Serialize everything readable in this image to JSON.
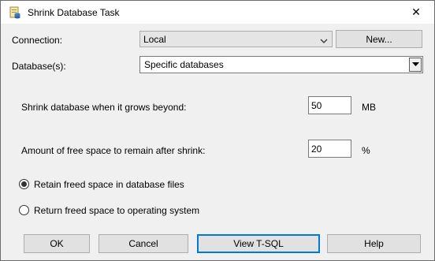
{
  "window": {
    "title": "Shrink Database Task",
    "close_symbol": "✕"
  },
  "icons": {
    "title": "database-task-icon",
    "close": "close-icon",
    "combo_arrow": "chevron-down-icon"
  },
  "connection": {
    "label": "Connection:",
    "value": "Local",
    "new_button": "New..."
  },
  "databases": {
    "label": "Database(s):",
    "value": "Specific databases"
  },
  "shrink": {
    "label": "Shrink database when it grows beyond:",
    "value": "50",
    "unit": "MB"
  },
  "free_space": {
    "label": "Amount of free space to remain after shrink:",
    "value": "20",
    "unit": "%"
  },
  "options": {
    "retain": {
      "label": "Retain freed space in database files",
      "selected": true
    },
    "return": {
      "label": "Return freed space to operating system",
      "selected": false
    }
  },
  "buttons": {
    "ok": "OK",
    "cancel": "Cancel",
    "view_tsql": "View T-SQL",
    "help": "Help"
  },
  "colors": {
    "default_button_border": "#0078d7",
    "dialog_background": "#f0f0f0"
  }
}
